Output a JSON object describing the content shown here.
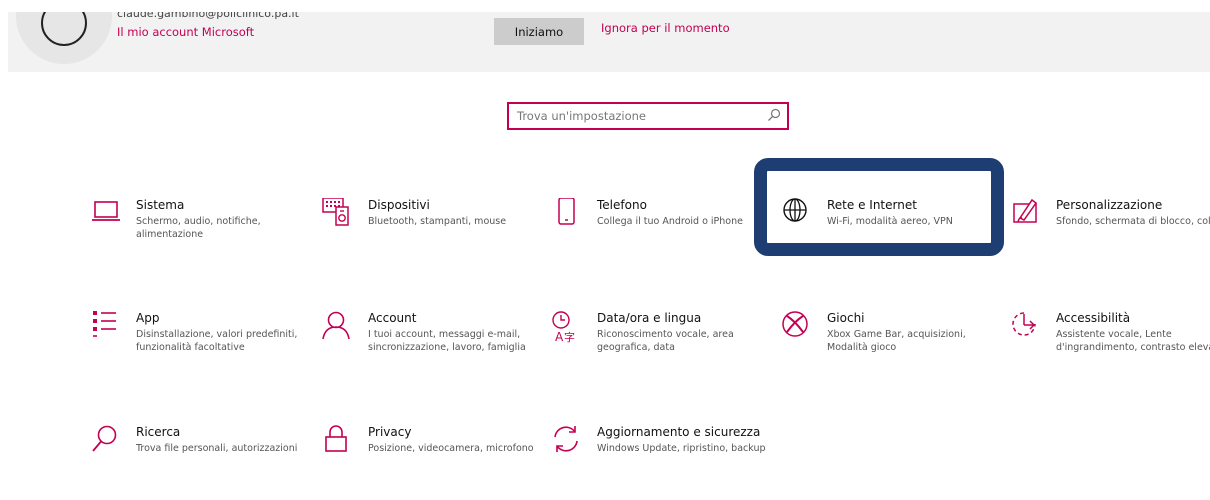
{
  "account": {
    "email": "claude.gambino@policlinico.pa.it",
    "link_label": "Il mio account Microsoft"
  },
  "banner": {
    "start_button": "Iniziamo",
    "skip_link": "Ignora per il momento"
  },
  "search": {
    "placeholder": "Trova un'impostazione"
  },
  "tiles": [
    {
      "title": "Sistema",
      "desc": "Schermo, audio, notifiche, alimentazione",
      "icon": "laptop-icon"
    },
    {
      "title": "Dispositivi",
      "desc": "Bluetooth, stampanti, mouse",
      "icon": "devices-icon"
    },
    {
      "title": "Telefono",
      "desc": "Collega il tuo Android o iPhone",
      "icon": "phone-icon"
    },
    {
      "title": "Rete e Internet",
      "desc": "Wi-Fi, modalità aereo, VPN",
      "icon": "globe-icon"
    },
    {
      "title": "Personalizzazione",
      "desc": "Sfondo, schermata di blocco, colori",
      "icon": "paint-icon"
    },
    {
      "title": "App",
      "desc": "Disinstallazione, valori predefiniti, funzionalità facoltative",
      "icon": "apps-list-icon"
    },
    {
      "title": "Account",
      "desc": "I tuoi account, messaggi e-mail, sincronizzazione, lavoro, famiglia",
      "icon": "person-icon"
    },
    {
      "title": "Data/ora e lingua",
      "desc": "Riconoscimento vocale, area geografica, data",
      "icon": "time-language-icon"
    },
    {
      "title": "Giochi",
      "desc": "Xbox Game Bar, acquisizioni, Modalità gioco",
      "icon": "xbox-icon"
    },
    {
      "title": "Accessibilità",
      "desc": "Assistente vocale, Lente d'ingrandimento, contrasto elevato",
      "icon": "accessibility-icon"
    },
    {
      "title": "Ricerca",
      "desc": "Trova file personali, autorizzazioni",
      "icon": "search-icon"
    },
    {
      "title": "Privacy",
      "desc": "Posizione, videocamera, microfono",
      "icon": "lock-icon"
    },
    {
      "title": "Aggiornamento e sicurezza",
      "desc": "Windows Update, ripristino, backup",
      "icon": "sync-icon"
    }
  ],
  "colors": {
    "accent": "#c30052",
    "highlight": "#1e3d73",
    "banner_bg": "#f2f2f2"
  }
}
